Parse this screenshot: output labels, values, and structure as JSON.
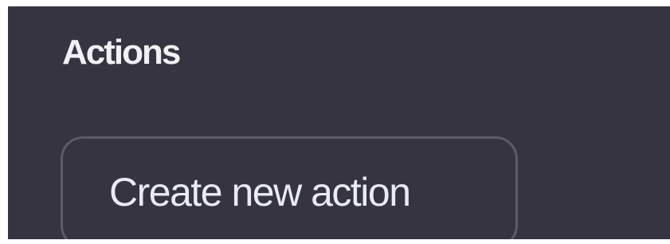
{
  "actions_panel": {
    "title": "Actions",
    "create_button_label": "Create new action"
  },
  "colors": {
    "panel_background": "#353440",
    "title_text": "#f1f1f5",
    "button_border": "#5c5b68",
    "button_text": "#e8eaf4"
  }
}
